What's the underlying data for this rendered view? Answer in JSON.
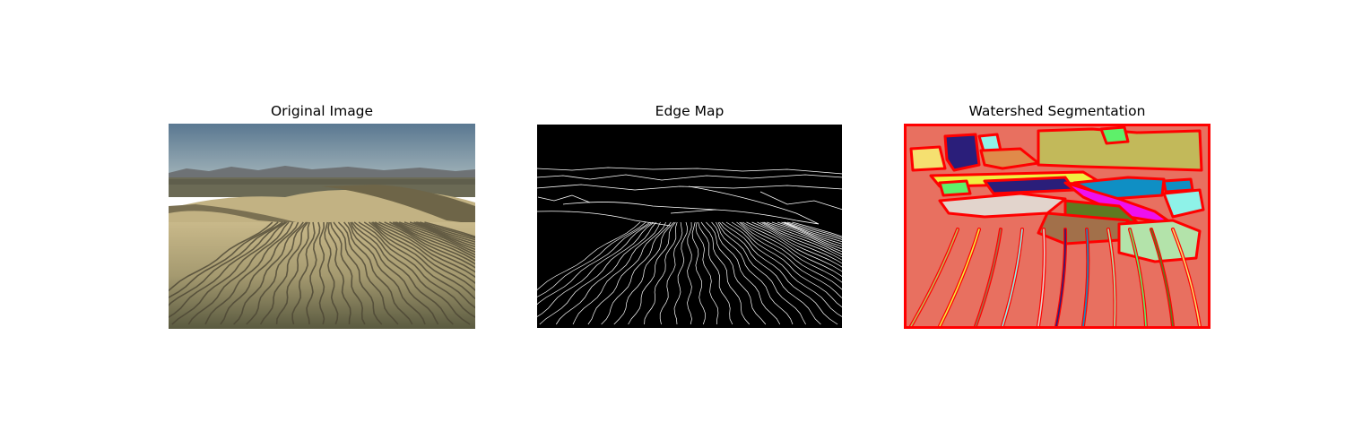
{
  "panels": [
    {
      "title": "Original Image"
    },
    {
      "title": "Edge Map"
    },
    {
      "title": "Watershed Segmentation"
    }
  ],
  "scene": {
    "content": "sand dunes with wind ripples under a clear sky, distant mountains on the horizon"
  },
  "colors": {
    "sky_top": "#5a7891",
    "sky_bottom": "#9fb0b5",
    "mountains": "#6e7275",
    "sand_light": "#c9b98a",
    "sand_shadow": "#6e6548",
    "edge_background": "#000000",
    "edge_lines": "#ffffff",
    "seg_boundary": "#ff0000",
    "seg_background": "#e87060",
    "seg_regions": [
      "#c2b95a",
      "#2a1e7a",
      "#f5e070",
      "#8ef2e8",
      "#5ef06a",
      "#f0f040",
      "#0f8fc4",
      "#ee10ee",
      "#e2d4cc",
      "#5f7a20",
      "#a2704a",
      "#b3e3aa"
    ]
  }
}
